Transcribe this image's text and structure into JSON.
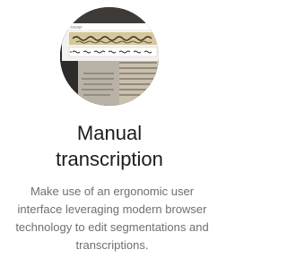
{
  "feature": {
    "image_alt": "screenshot of transcription interface over a manuscript page",
    "app_header_text": "eScript",
    "title_line1": "Manual",
    "title_line2": "transcription",
    "description": "Make use of an ergonomic user interface leveraging modern browser technology to edit segmentations and transcriptions."
  },
  "colors": {
    "title": "#1c1c1c",
    "description": "#6f6f6f",
    "manuscript_paper": "#d9cfb8",
    "manuscript_dark": "#3a3836",
    "highlight_box": "#d9c48a",
    "ink": "#2a2a2a"
  }
}
